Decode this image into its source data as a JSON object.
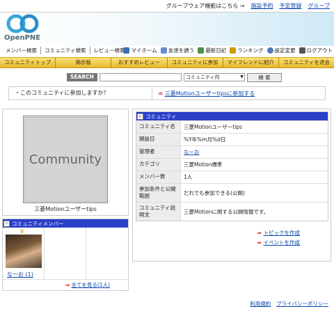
{
  "topbar": {
    "promo": "グループウェア機能はこちら →",
    "links": [
      "施設予約",
      "予定登録",
      "グループ"
    ]
  },
  "header": {
    "logo_text": "OpenPNE",
    "logo_icon": "openpne-logo-circles"
  },
  "subnav": {
    "search_links": [
      "メンバー検索",
      "コミュニティ検索",
      "レビュー検索"
    ],
    "home_links": [
      {
        "label": "マイホーム",
        "icon": "home-icon",
        "color": "#3a6fb0"
      },
      {
        "label": "友達を誘う",
        "icon": "invite-icon",
        "color": "#6a8bd0"
      },
      {
        "label": "最新日記",
        "icon": "diary-icon",
        "color": "#4b8f4b"
      },
      {
        "label": "ランキング",
        "icon": "ranking-icon",
        "color": "#d19a00"
      },
      {
        "label": "設定変更",
        "icon": "settings-icon",
        "color": "#4a7ab8"
      },
      {
        "label": "ログアウト",
        "icon": "logout-icon",
        "color": "#555555"
      }
    ]
  },
  "menubar": {
    "items": [
      "コミュニティトップ",
      "掲示板",
      "おすすめレビュー",
      "コミュニティに参加",
      "マイフレンドに紹介",
      "コミュニティを退会"
    ]
  },
  "search": {
    "label": "SEARCH",
    "input_value": "",
    "scope": "コミュニティ内",
    "button": "検 索"
  },
  "join": {
    "question": "・このコミュニティに参加しますか？",
    "link": "三菱Motionユーザーtipsに参加する"
  },
  "community": {
    "placeholder_image_text": "Community",
    "name": "三菱Motionユーザーtips"
  },
  "members": {
    "title": "コミュニティメンバー",
    "items": [
      {
        "name": "なーお (1)",
        "is_admin": true
      }
    ],
    "see_all": "全てを見る(1人)"
  },
  "info": {
    "title": "コミュニティ",
    "rows": [
      {
        "key": "コミュニティ名",
        "value": "三菱Motionユーザーtips",
        "link": false
      },
      {
        "key": "開設日",
        "value": "%Y年%m月%d日",
        "link": false
      },
      {
        "key": "管理者",
        "value": "なーお",
        "link": true
      },
      {
        "key": "カテゴリ",
        "value": "三菱Motion標準",
        "link": false
      },
      {
        "key": "メンバー数",
        "value": "1人",
        "link": false
      },
      {
        "key": "参加条件と公開範囲",
        "value": "だれでも参加できる(公開)",
        "link": false
      },
      {
        "key": "コミュニティ説明文",
        "value": "三菱Motionに関する公開情報です。",
        "link": false
      }
    ]
  },
  "actions": [
    "トピックを作成",
    "イベントを作成"
  ],
  "footer": [
    "利用規約",
    "プライバシーポリシー"
  ],
  "colors": {
    "menubar": "#f0c84a",
    "section_header": "#2a40c8",
    "link": "#0645ad"
  }
}
